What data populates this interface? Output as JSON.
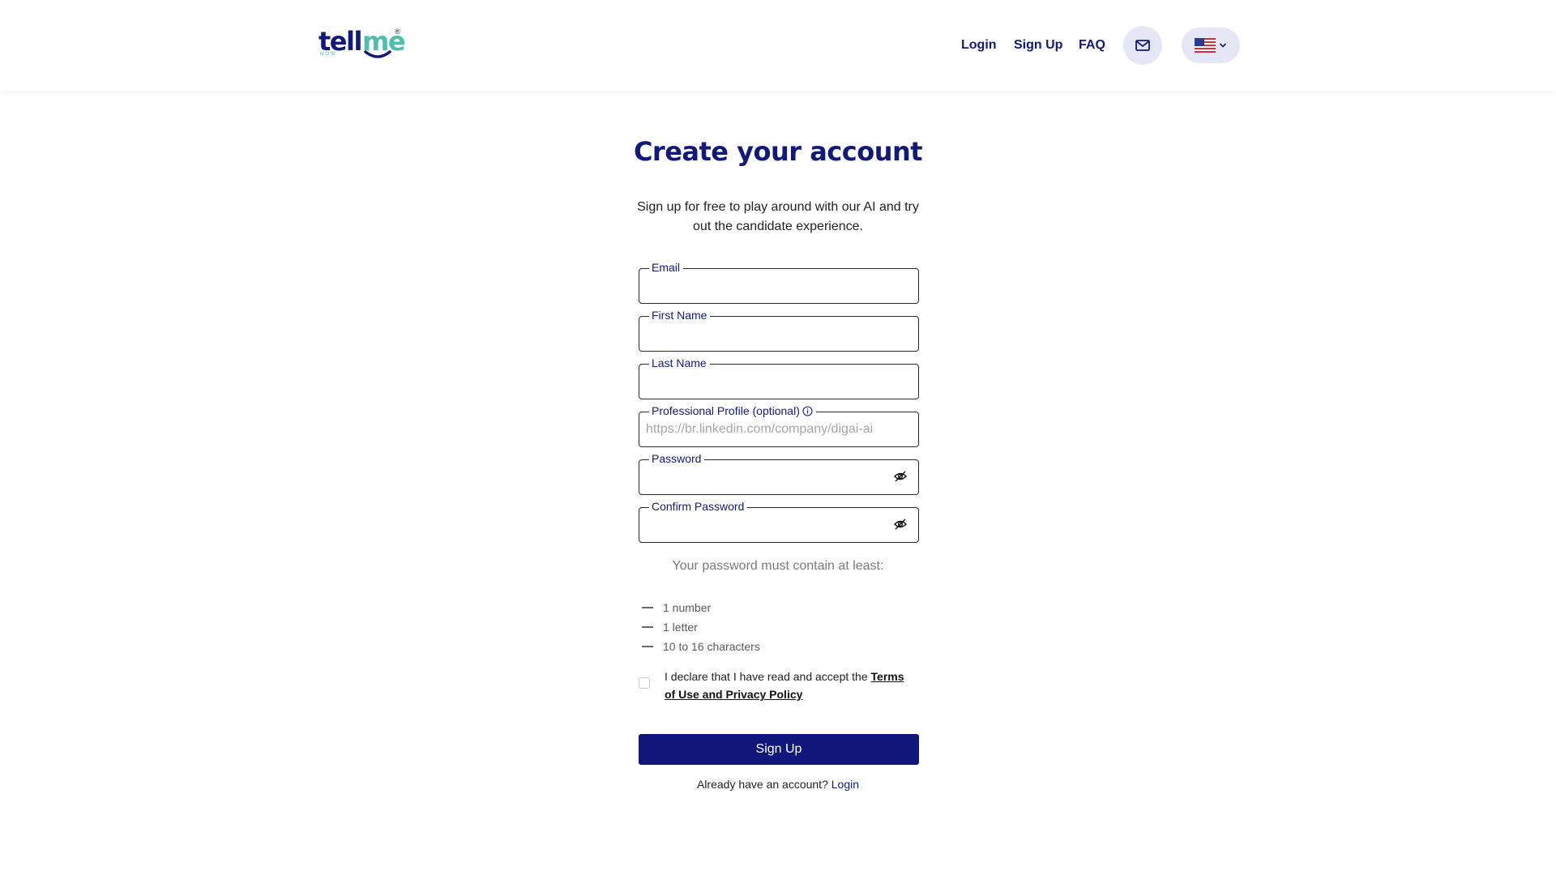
{
  "header": {
    "logo": {
      "tell": "tell",
      "me": "me",
      "now": "NOW",
      "reg": "®"
    },
    "nav": {
      "login": "Login",
      "signup": "Sign Up",
      "faq": "FAQ"
    },
    "mail_icon": "envelope-icon",
    "language_icon": "us-flag-icon"
  },
  "main": {
    "title": "Create your account",
    "subtitle": "Sign up for free to play around with our AI and try out the candidate experience.",
    "fields": {
      "email": {
        "label": "Email",
        "value": ""
      },
      "first_name": {
        "label": "First Name",
        "value": ""
      },
      "last_name": {
        "label": "Last Name",
        "value": ""
      },
      "profile": {
        "label": "Professional Profile (optional)",
        "placeholder": "https://br.linkedin.com/company/digai-ai",
        "value": ""
      },
      "password": {
        "label": "Password",
        "value": ""
      },
      "confirm_password": {
        "label": "Confirm Password",
        "value": ""
      }
    },
    "requirements": {
      "title": "Your password must contain at least:",
      "items": [
        "1 number",
        "1 letter",
        "10 to 16 characters"
      ]
    },
    "terms": {
      "text": "I declare that I have read and accept the ",
      "link": "Terms of Use and Privacy Policy",
      "checked": false
    },
    "signup_button": "Sign Up",
    "already": {
      "text": "Already have an account? ",
      "link": "Login"
    }
  },
  "colors": {
    "brand_navy": "#111a7a",
    "brand_teal": "#4dbfae",
    "button": "#10167a",
    "icon_bg": "#e6e7f6"
  }
}
